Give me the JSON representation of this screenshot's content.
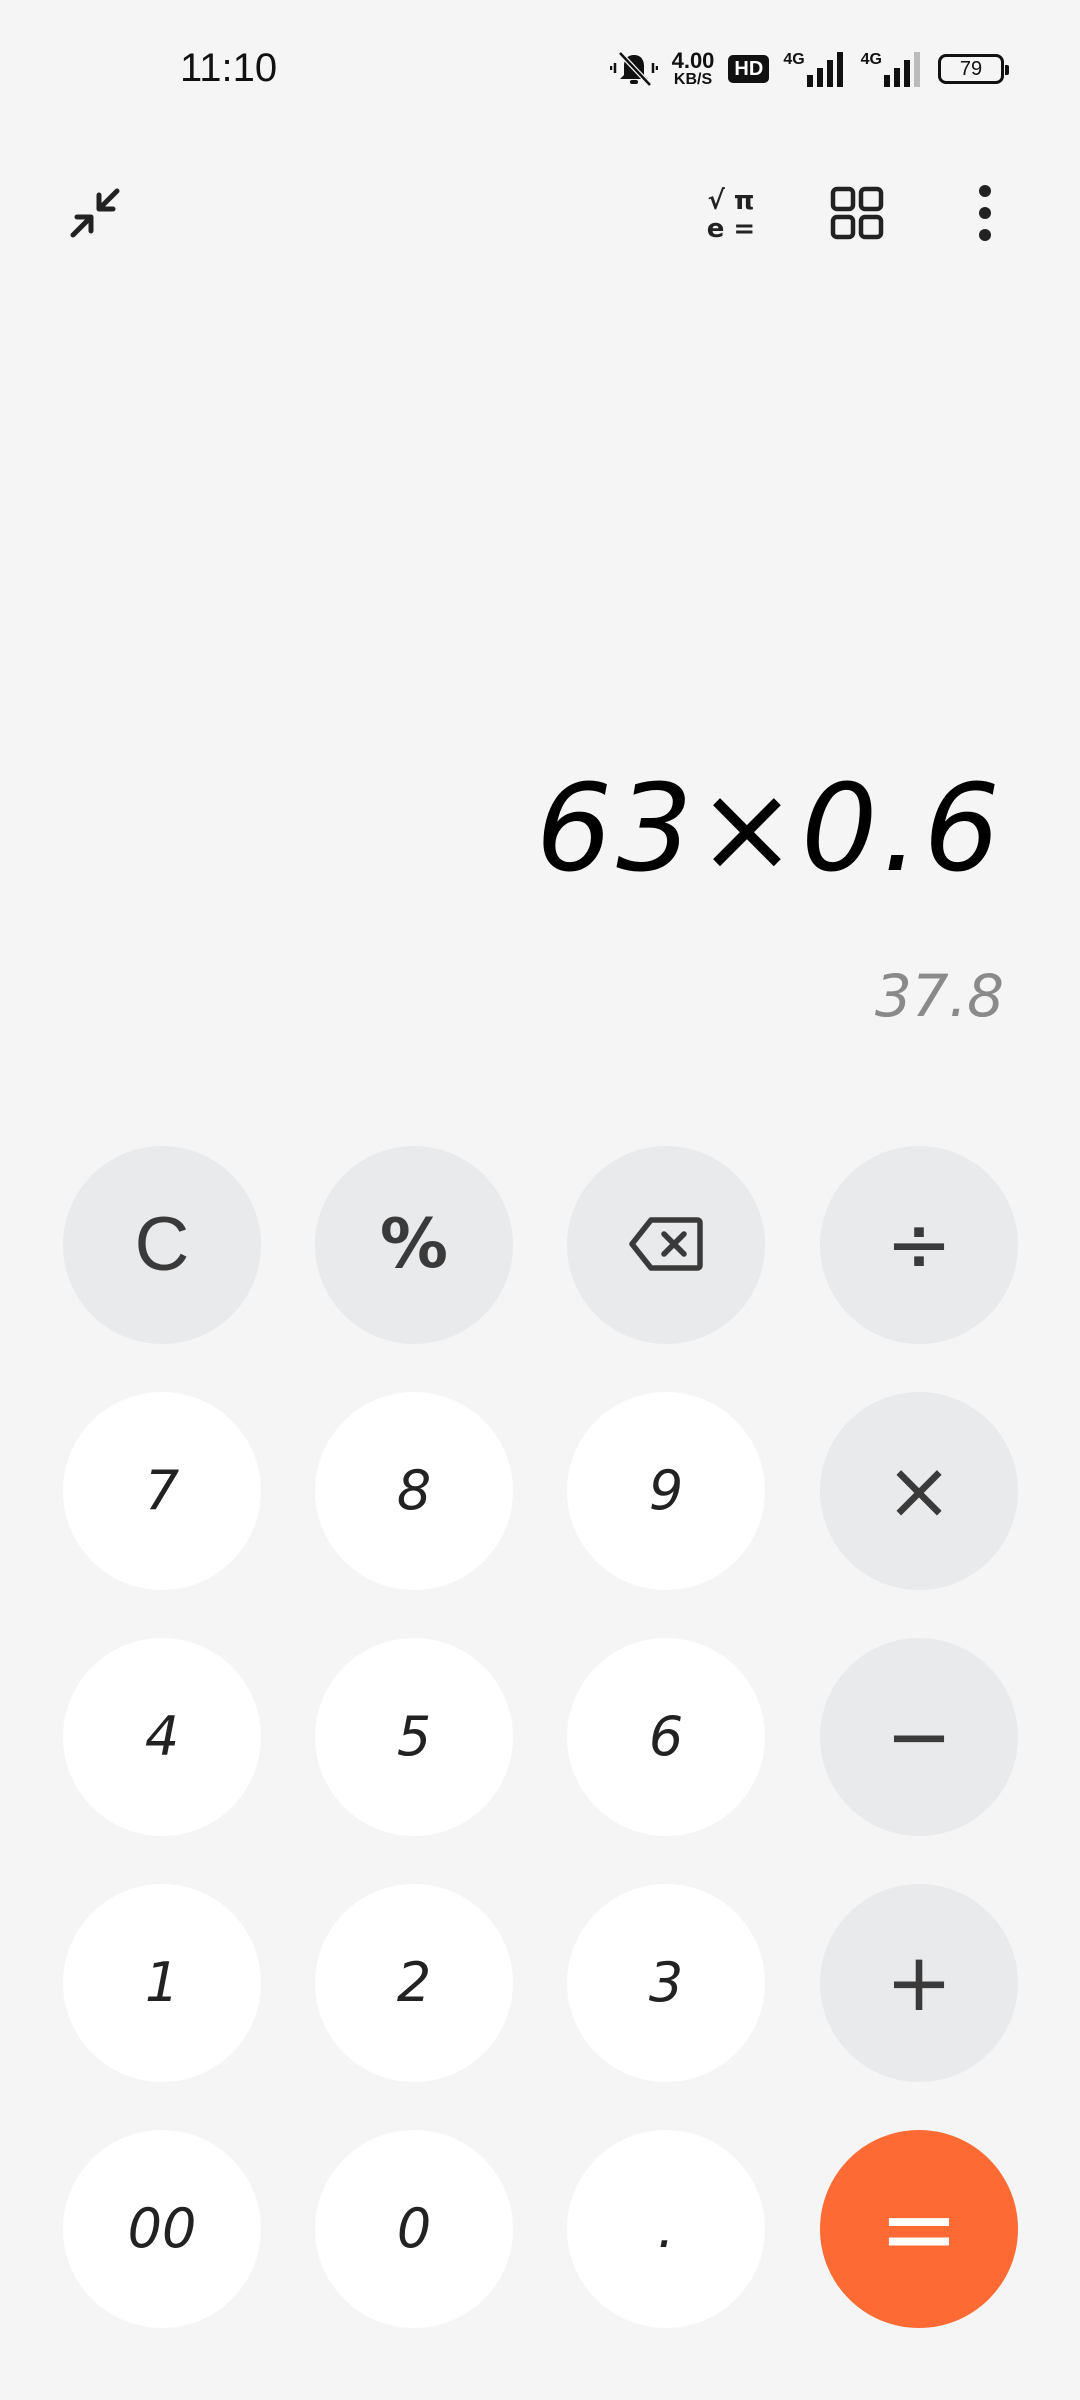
{
  "status_bar": {
    "time": "11:10",
    "net_speed_value": "4.00",
    "net_speed_unit": "KB/S",
    "hd_label": "HD",
    "signal_1_label": "4G",
    "signal_2_label": "4G",
    "battery_level": "79",
    "icons": [
      "mute-vibrate-icon",
      "signal-icon",
      "battery-icon"
    ]
  },
  "toolbar": {
    "scientific_top": "√ π",
    "scientific_bottom": "e =",
    "icons": [
      "collapse-icon",
      "scientific-icon",
      "grid-icon",
      "more-icon"
    ]
  },
  "display": {
    "expression": "63×0.6",
    "result": "37.8"
  },
  "keypad": {
    "clear": "C",
    "percent": "%",
    "divide": "÷",
    "multiply": "×",
    "minus": "−",
    "plus": "+",
    "equals": "=",
    "seven": "7",
    "eight": "8",
    "nine": "9",
    "four": "4",
    "five": "5",
    "six": "6",
    "one": "1",
    "two": "2",
    "three": "3",
    "double_zero": "00",
    "zero": "0",
    "decimal": "."
  },
  "colors": {
    "background": "#f5f5f5",
    "number_key": "#ffffff",
    "function_key": "#e9eaec",
    "equals_key": "#fe6a34",
    "result_text": "#8a8a8a"
  }
}
